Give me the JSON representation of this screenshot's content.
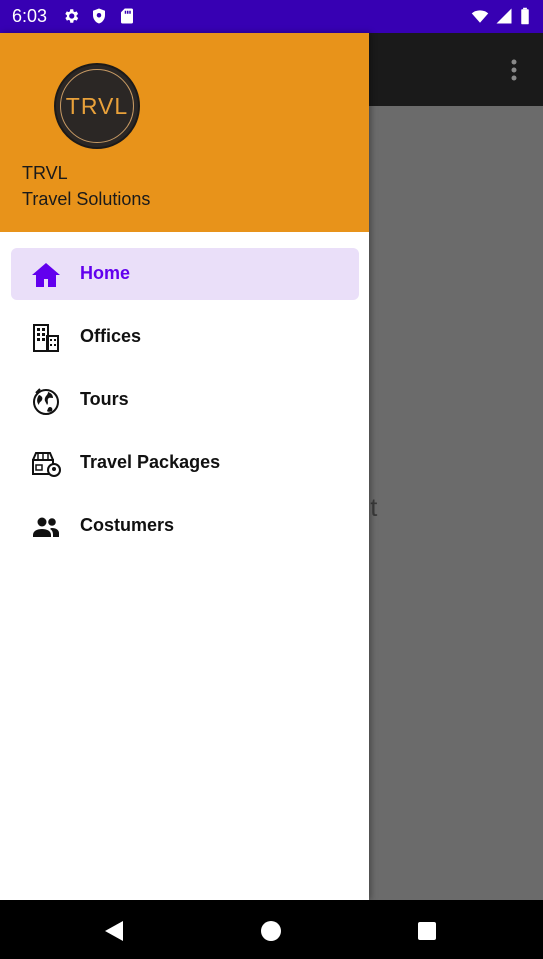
{
  "status_bar": {
    "time": "6:03",
    "left_icons": [
      "settings-gear-icon",
      "shield-icon",
      "sd-card-icon"
    ],
    "right_icons": [
      "wifi-icon",
      "signal-icon",
      "battery-icon"
    ],
    "color": "#3700b3"
  },
  "app": {
    "toolbar_icon": "overflow-menu-icon",
    "content_text": "ent"
  },
  "drawer": {
    "header": {
      "logo_text": "TRVL",
      "title": "TRVL",
      "subtitle": "Travel Solutions",
      "background": "#e8931a"
    },
    "items": [
      {
        "label": "Home",
        "icon": "home-icon",
        "active": true
      },
      {
        "label": "Offices",
        "icon": "office-building-icon",
        "active": false
      },
      {
        "label": "Tours",
        "icon": "globe-icon",
        "active": false
      },
      {
        "label": "Travel Packages",
        "icon": "travel-package-icon",
        "active": false
      },
      {
        "label": "Costumers",
        "icon": "people-icon",
        "active": false
      }
    ],
    "accent": "#6200ee",
    "active_background": "#eadff9"
  },
  "nav_bar": {
    "buttons": [
      "back-icon",
      "home-circle-icon",
      "recents-icon"
    ]
  }
}
